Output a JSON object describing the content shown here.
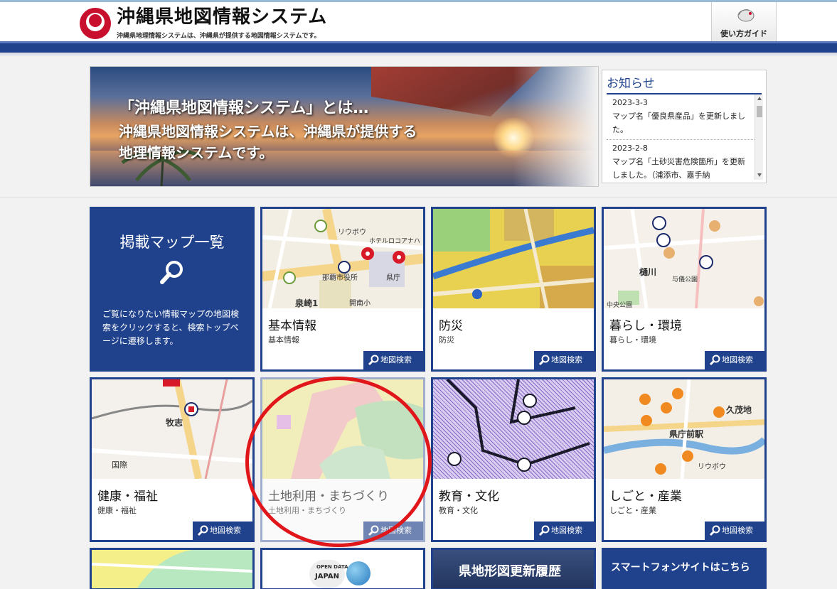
{
  "header": {
    "title": "沖縄県地図情報システム",
    "subtitle": "沖縄県地理情報システムは、沖縄県が提供する地図情報システムです。",
    "guide_label": "使い方ガイド"
  },
  "banner": {
    "line1": "「沖縄県地図情報システム」とは…",
    "line2": "沖縄県地図情報システムは、沖縄県が提供する",
    "line3": "地理情報システムです。"
  },
  "notices": {
    "title": "お知らせ",
    "items": [
      {
        "date": "2023-3-3",
        "text": "マップ名「優良県産品」を更新しました。"
      },
      {
        "date": "2023-2-8",
        "text": "マップ名「土砂災害危険箇所」を更新しました。（浦添市、嘉手納"
      }
    ]
  },
  "map_list": {
    "title": "掲載マップ一覧",
    "description": "ご覧になりたい情報マップの地図検索をクリックすると、検索トップページに遷移します。"
  },
  "search_label": "地図検索",
  "categories": [
    {
      "title": "基本情報",
      "sub": "基本情報"
    },
    {
      "title": "防災",
      "sub": "防災"
    },
    {
      "title": "暮らし・環境",
      "sub": "暮らし・環境"
    },
    {
      "title": "健康・福祉",
      "sub": "健康・福祉"
    },
    {
      "title": "土地利用・まちづくり",
      "sub": "土地利用・まちづくり"
    },
    {
      "title": "教育・文化",
      "sub": "教育・文化"
    },
    {
      "title": "しごと・産業",
      "sub": "しごと・産業"
    }
  ],
  "bottom": {
    "prefectural_map_label": "県地形図更新履歴",
    "smartphone_label": "スマートフォンサイトはこちら",
    "opendata_line1": "OPEN DATA",
    "opendata_line2": "JAPAN"
  },
  "map_labels": {
    "basic_1": "リウボウ",
    "basic_2": "那覇市役所",
    "basic_3": "県庁",
    "basic_4": "泉崎1",
    "basic_5": "開南小",
    "basic_6": "ホテルロコアナハ",
    "life_1": "樋川",
    "life_2": "与儀公園",
    "life_3": "中央公園",
    "health_1": "牧志",
    "health_2": "国際",
    "work_1": "久茂地",
    "work_2": "県庁前駅",
    "work_3": "リウボウ"
  },
  "colors": {
    "primary": "#20428c",
    "highlight": "#e0161b"
  }
}
